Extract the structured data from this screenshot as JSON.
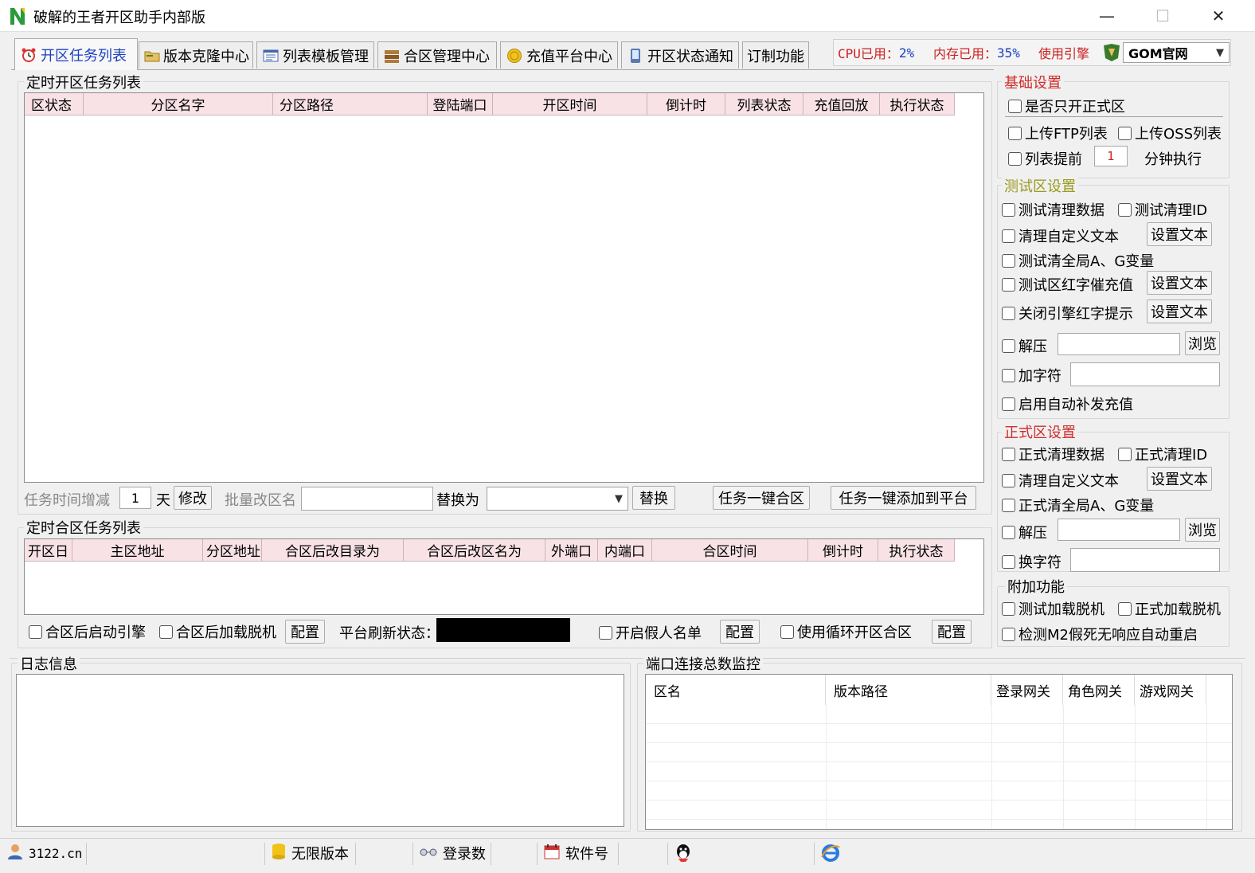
{
  "window": {
    "title": "破解的王者开区助手内部版",
    "minimize": "—",
    "maximize": "☐",
    "close": "✕"
  },
  "tabs": [
    {
      "label": "开区任务列表",
      "icon": "alarm-clock-icon"
    },
    {
      "label": "版本克隆中心",
      "icon": "folder-icon"
    },
    {
      "label": "列表模板管理",
      "icon": "list-icon"
    },
    {
      "label": "合区管理中心",
      "icon": "cabinet-icon"
    },
    {
      "label": "充值平台中心",
      "icon": "coin-icon"
    },
    {
      "label": "开区状态通知",
      "icon": "phone-icon"
    },
    {
      "label": "订制功能",
      "icon": ""
    }
  ],
  "status": {
    "cpu_label": "CPU已用：",
    "cpu_value": "2%",
    "mem_label": "内存已用：",
    "mem_value": "35%",
    "engine_label": "使用引擎",
    "engine_value": "GOM官网"
  },
  "timed_open": {
    "title": "定时开区任务列表",
    "columns": [
      "区状态",
      "分区名字",
      "分区路径",
      "登陆端口",
      "开区时间",
      "倒计时",
      "列表状态",
      "充值回放",
      "执行状态"
    ]
  },
  "open_controls": {
    "time_inc_label": "任务时间增减",
    "days_value": "1",
    "days_unit": "天",
    "modify": "修改",
    "batch_label": "批量改区名",
    "replace_with_label": "替换为",
    "replace": "替换",
    "merge_all": "任务一键合区",
    "add_all": "任务一键添加到平台"
  },
  "timed_merge": {
    "title": "定时合区任务列表",
    "columns": [
      "开区日",
      "主区地址",
      "分区地址",
      "合区后改目录为",
      "合区后改区名为",
      "外端口",
      "内端口",
      "合区时间",
      "倒计时",
      "执行状态"
    ]
  },
  "merge_controls": {
    "start_engine": "合区后启动引擎",
    "load_offline": "合区后加载脱机",
    "config1": "配置",
    "platform_refresh": "平台刷新状态：",
    "fake_names": "开启假人名单",
    "config2": "配置",
    "cycle": "使用循环开区合区",
    "config3": "配置"
  },
  "log": {
    "title": "日志信息"
  },
  "port_monitor": {
    "title": "端口连接总数监控",
    "columns": [
      "区名",
      "版本路径",
      "登录网关",
      "角色网关",
      "游戏网关"
    ]
  },
  "basic": {
    "title": "基础设置",
    "only_official": "是否只开正式区",
    "upload_ftp": "上传FTP列表",
    "upload_oss": "上传OSS列表",
    "list_ahead": "列表提前",
    "minutes_value": "1",
    "minutes_exec": "分钟执行"
  },
  "test": {
    "title": "测试区设置",
    "clear_data": "测试清理数据",
    "clear_id": "测试清理ID",
    "clear_custom": "清理自定义文本",
    "set_text": "设置文本",
    "clear_global": "测试清全局A、G变量",
    "red_recharge": "测试区红字催充值",
    "close_engine": "关闭引擎红字提示",
    "unzip": "解压",
    "browse": "浏览",
    "add_char": "加字符",
    "auto_recharge": "启用自动补发充值"
  },
  "official": {
    "title": "正式区设置",
    "clear_data": "正式清理数据",
    "clear_id": "正式清理ID",
    "clear_custom": "清理自定义文本",
    "set_text": "设置文本",
    "clear_global": "正式清全局A、G变量",
    "unzip": "解压",
    "browse": "浏览",
    "replace_char": "换字符"
  },
  "extra": {
    "title": "附加功能",
    "test_offline": "测试加载脱机",
    "official_offline": "正式加载脱机",
    "m2_restart": "检测M2假死无响应自动重启"
  },
  "statusbar": {
    "site": "3122.cn",
    "unlimited": "无限版本",
    "logins": "登录数",
    "software": "软件号"
  },
  "colors": {
    "accent_blue": "#1a3fc0",
    "header_pink": "#f8e2e6",
    "section_red": "#d12b2b",
    "section_olive": "#9a9a1e"
  }
}
